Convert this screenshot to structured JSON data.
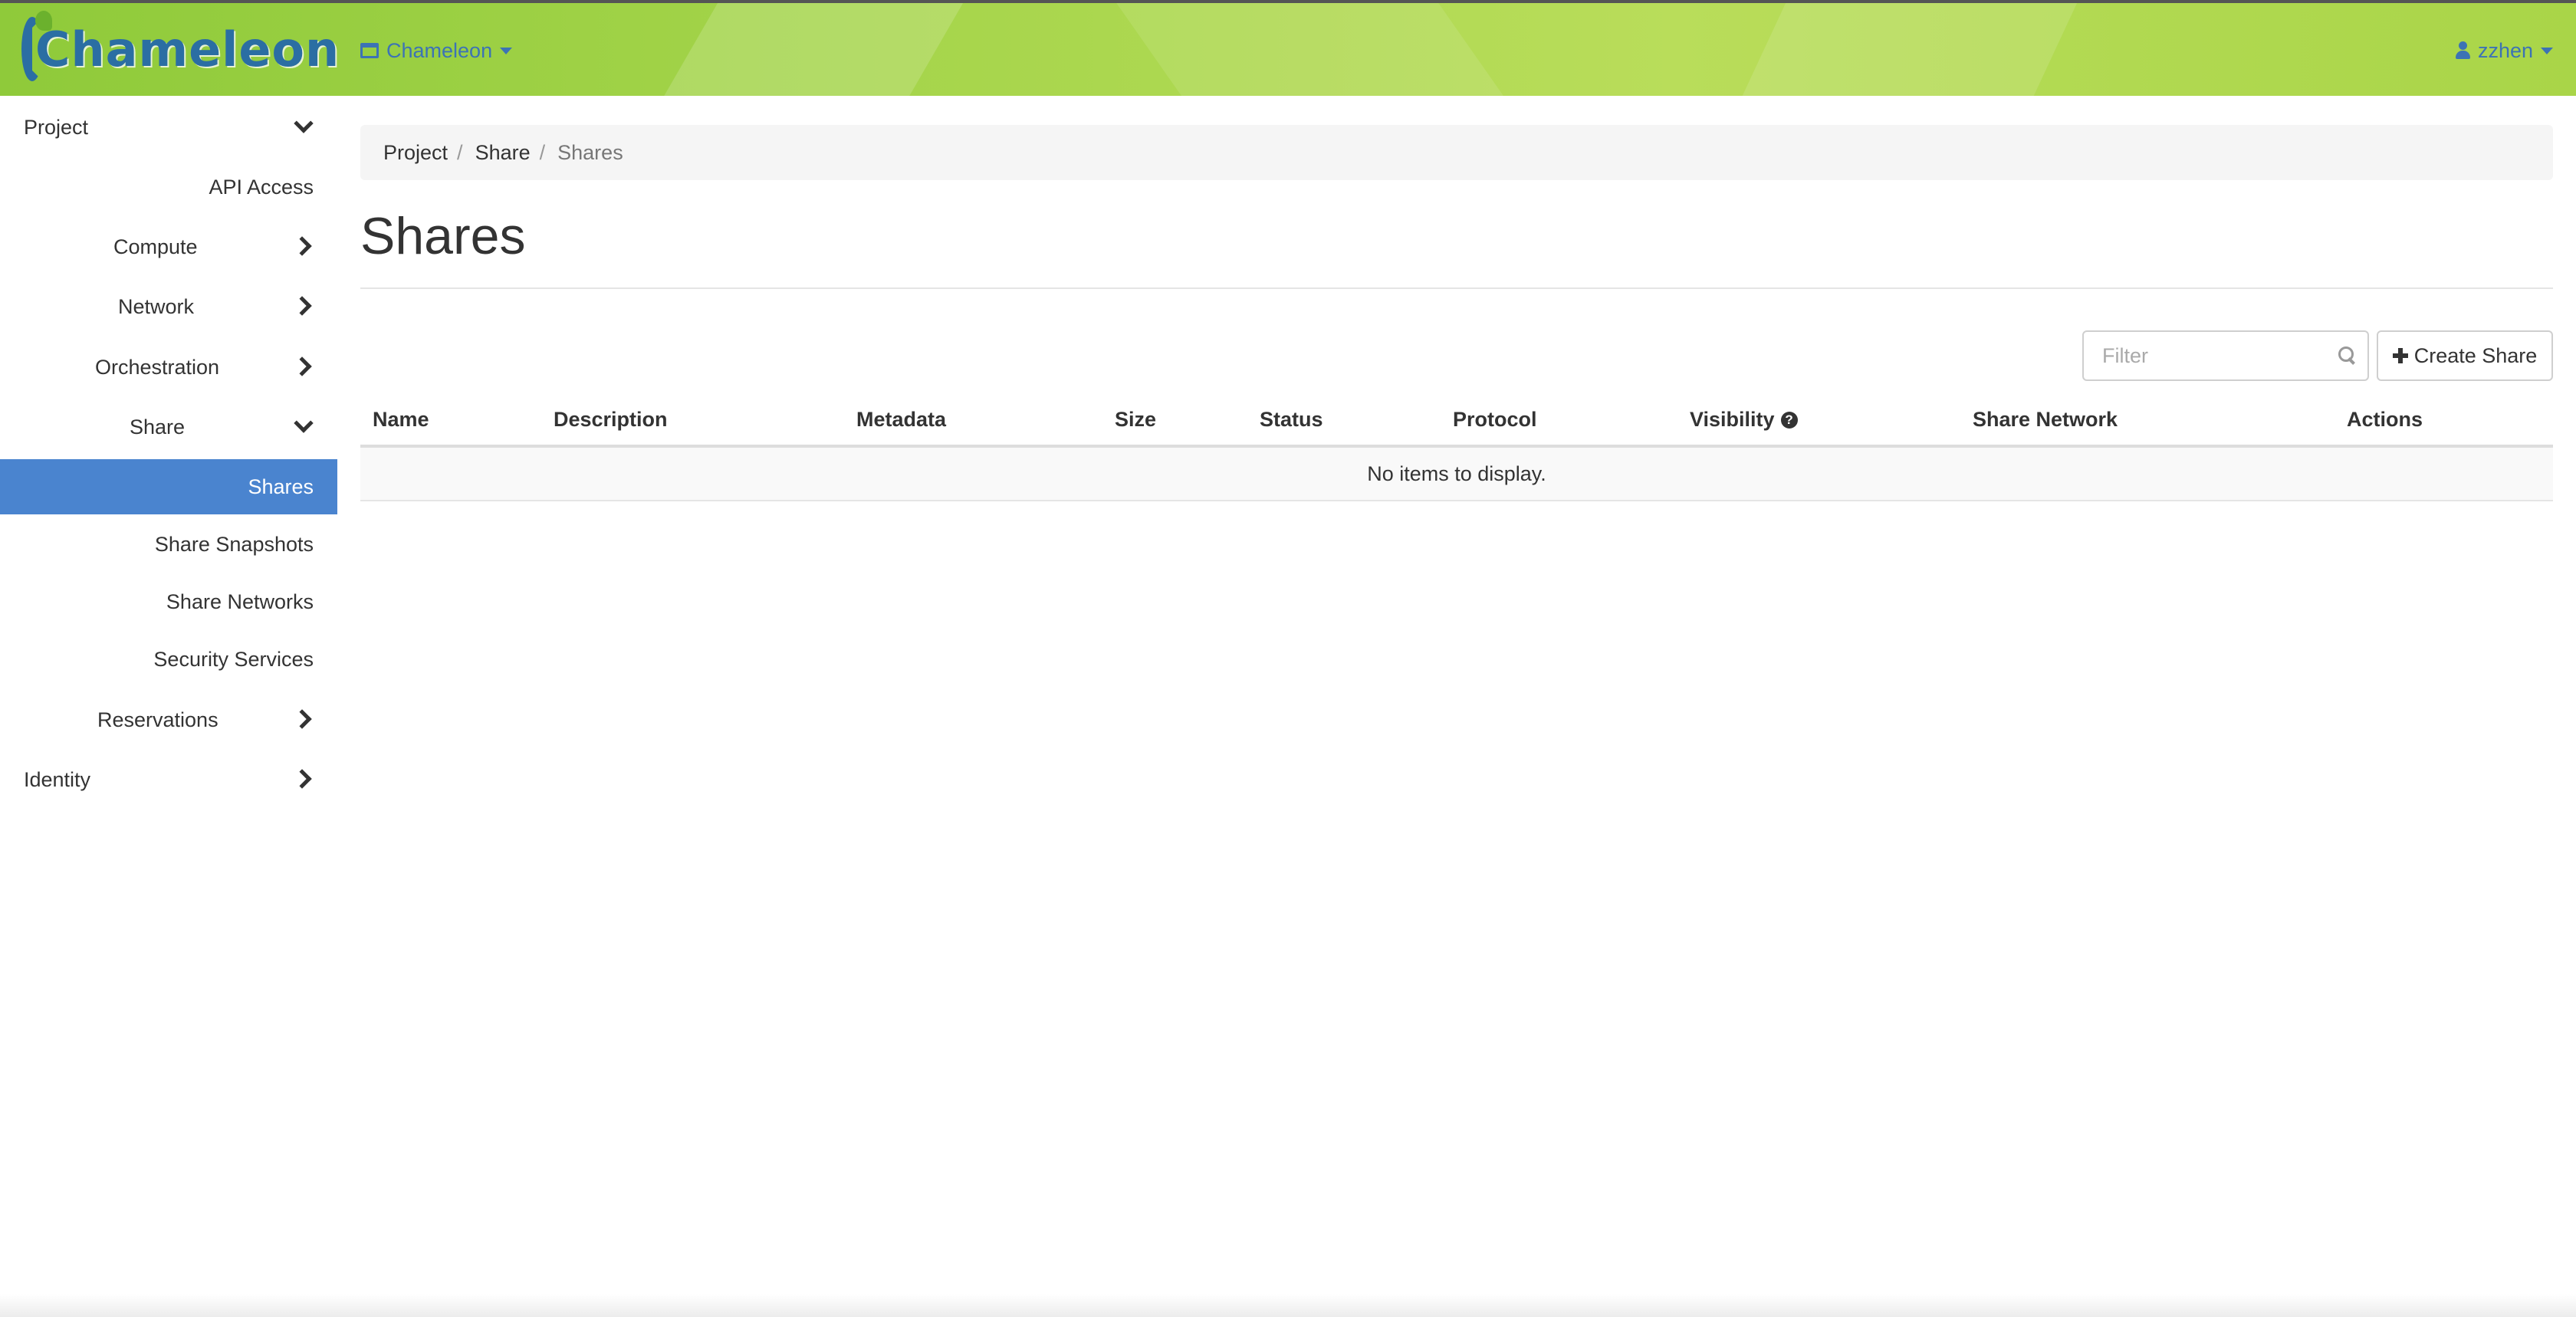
{
  "header": {
    "logo_text": "Chameleon",
    "project_switcher": "Chameleon",
    "user": "zzhen",
    "colors": {
      "bar_start": "#8fca3a",
      "bar_end": "#b9dd5a",
      "link": "#3c73b5"
    }
  },
  "sidebar": {
    "active_color": "#4a84cf",
    "items": [
      {
        "label": "Project",
        "chevron": "chevron-down-icon"
      },
      {
        "label": "API Access"
      },
      {
        "label": "Compute",
        "chevron": "chevron-right-icon"
      },
      {
        "label": "Network",
        "chevron": "chevron-right-icon"
      },
      {
        "label": "Orchestration",
        "chevron": "chevron-right-icon"
      },
      {
        "label": "Share",
        "chevron": "chevron-down-icon"
      },
      {
        "label": "Shares",
        "active": true
      },
      {
        "label": "Share Snapshots"
      },
      {
        "label": "Share Networks"
      },
      {
        "label": "Security Services"
      },
      {
        "label": "Reservations",
        "chevron": "chevron-right-icon"
      },
      {
        "label": "Identity",
        "chevron": "chevron-right-icon"
      }
    ]
  },
  "breadcrumb": {
    "items": [
      "Project",
      "Share",
      "Shares"
    ],
    "separator": "/"
  },
  "main": {
    "title": "Shares",
    "filter_placeholder": "Filter",
    "create_label": "Create Share",
    "table": {
      "columns": [
        "Name",
        "Description",
        "Metadata",
        "Size",
        "Status",
        "Protocol",
        "Visibility",
        "Share Network",
        "Actions"
      ],
      "empty_message": "No items to display."
    }
  }
}
